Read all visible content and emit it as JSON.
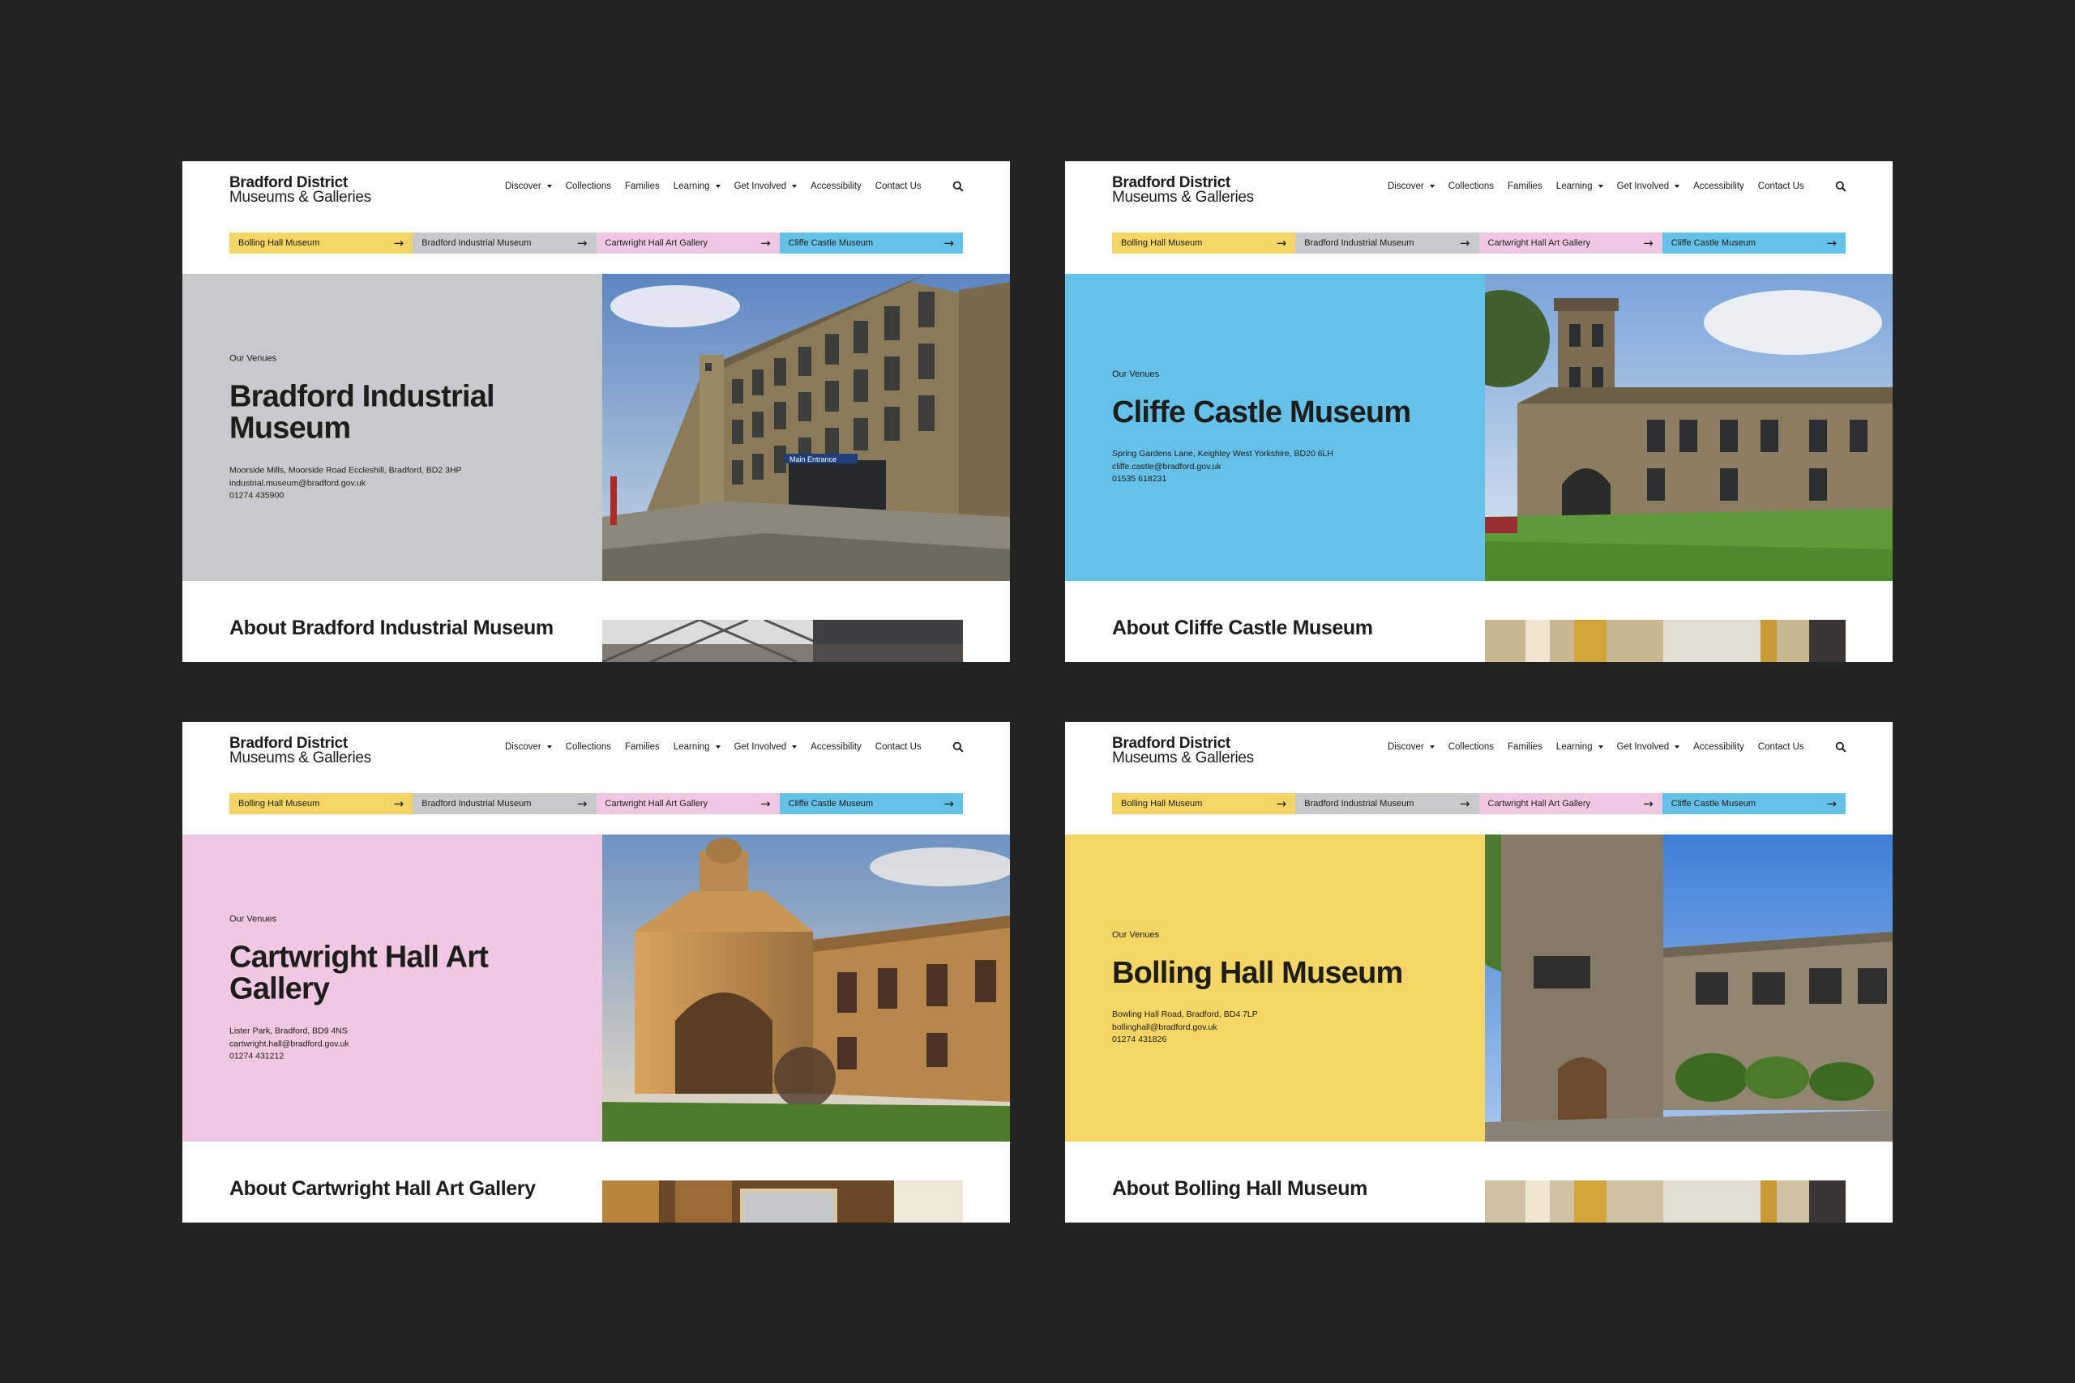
{
  "site": {
    "logo_line1": "Bradford District",
    "logo_line2": "Museums & Galleries"
  },
  "nav": [
    {
      "label": "Discover",
      "dropdown": true
    },
    {
      "label": "Collections",
      "dropdown": false
    },
    {
      "label": "Families",
      "dropdown": false
    },
    {
      "label": "Learning",
      "dropdown": true
    },
    {
      "label": "Get Involved",
      "dropdown": true
    },
    {
      "label": "Accessibility",
      "dropdown": false
    },
    {
      "label": "Contact Us",
      "dropdown": false
    }
  ],
  "venue_tabs": [
    {
      "label": "Bolling Hall Museum",
      "color": "#f5d565"
    },
    {
      "label": "Bradford Industrial Museum",
      "color": "#c8c9ca"
    },
    {
      "label": "Cartwright Hall Art Gallery",
      "color": "#f1c8e1"
    },
    {
      "label": "Cliffe Castle Museum",
      "color": "#66c1e8"
    }
  ],
  "colors": {
    "background": "#232323",
    "yellow": "#f5d565",
    "grey": "#c8c9ca",
    "pink": "#f1c8e1",
    "blue": "#66c1e8",
    "text": "#1d1d1b"
  },
  "pages": [
    {
      "eyebrow": "Our Venues",
      "title": "Bradford Industrial Museum",
      "address": "Moorside Mills, Moorside Road Eccleshill, Bradford, BD2 3HP",
      "email": "industrial.museum@bradford.gov.uk",
      "phone": "01274 435900",
      "about_title": "About Bradford Industrial Museum",
      "hero_color": "#c8c9ca",
      "photo_sign": "Main Entrance"
    },
    {
      "eyebrow": "Our Venues",
      "title": "Cliffe Castle Museum",
      "address": "Spring Gardens Lane, Keighley West Yorkshire, BD20 6LH",
      "email": "cliffe.castle@bradford.gov.uk",
      "phone": "01535 618231",
      "about_title": "About Cliffe Castle Museum",
      "hero_color": "#66c1e8"
    },
    {
      "eyebrow": "Our Venues",
      "title": "Cartwright Hall Art Gallery",
      "address": "Lister Park, Bradford, BD9 4NS",
      "email": "cartwright.hall@bradford.gov.uk",
      "phone": "01274 431212",
      "about_title": "About Cartwright Hall Art Gallery",
      "hero_color": "#f1c8e1"
    },
    {
      "eyebrow": "Our Venues",
      "title": "Bolling Hall Museum",
      "address": "Bowling Hall Road, Bradford, BD4 7LP",
      "email": "bollinghall@bradford.gov.uk",
      "phone": "01274 431826",
      "about_title": "About Bolling Hall Museum",
      "hero_color": "#f5d565"
    }
  ]
}
